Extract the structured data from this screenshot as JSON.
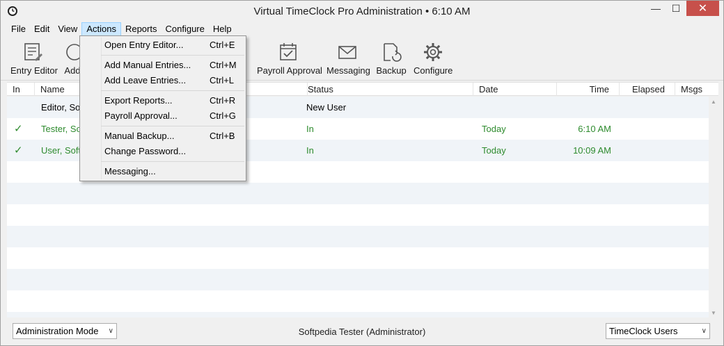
{
  "window": {
    "title": "Virtual TimeClock Pro Administration • 6:10 AM",
    "minimize": "—",
    "maximize": "☐",
    "close": "✕"
  },
  "menubar": {
    "items": [
      "File",
      "Edit",
      "View",
      "Actions",
      "Reports",
      "Configure",
      "Help"
    ]
  },
  "toolbar": {
    "entry_editor": "Entry Editor",
    "add": "Add",
    "payroll_approval": "Payroll Approval",
    "messaging": "Messaging",
    "backup": "Backup",
    "configure": "Configure"
  },
  "table": {
    "columns": [
      "In",
      "Name",
      "Status",
      "Date",
      "Time",
      "Elapsed",
      "Msgs"
    ],
    "rows": [
      {
        "in": "",
        "name": "Editor, Soft",
        "status": "New User",
        "date": "",
        "time": "",
        "green": false
      },
      {
        "in": "✓",
        "name": "Tester, Soft",
        "status": "In",
        "date": "Today",
        "time": "6:10 AM",
        "green": true
      },
      {
        "in": "✓",
        "name": "User, Softp",
        "status": "In",
        "date": "Today",
        "time": "10:09 AM",
        "green": true
      }
    ]
  },
  "statusbar": {
    "mode": "Administration Mode",
    "user": "Softpedia Tester (Administrator)",
    "view": "TimeClock Users"
  },
  "actions_menu": {
    "groups": [
      [
        {
          "label": "Open Entry Editor...",
          "shortcut": "Ctrl+E"
        }
      ],
      [
        {
          "label": "Add Manual Entries...",
          "shortcut": "Ctrl+M"
        },
        {
          "label": "Add Leave Entries...",
          "shortcut": "Ctrl+L"
        }
      ],
      [
        {
          "label": "Export Reports...",
          "shortcut": "Ctrl+R"
        },
        {
          "label": "Payroll Approval...",
          "shortcut": "Ctrl+G"
        }
      ],
      [
        {
          "label": "Manual Backup...",
          "shortcut": "Ctrl+B"
        },
        {
          "label": "Change Password...",
          "shortcut": ""
        }
      ],
      [
        {
          "label": "Messaging...",
          "shortcut": ""
        }
      ]
    ]
  }
}
